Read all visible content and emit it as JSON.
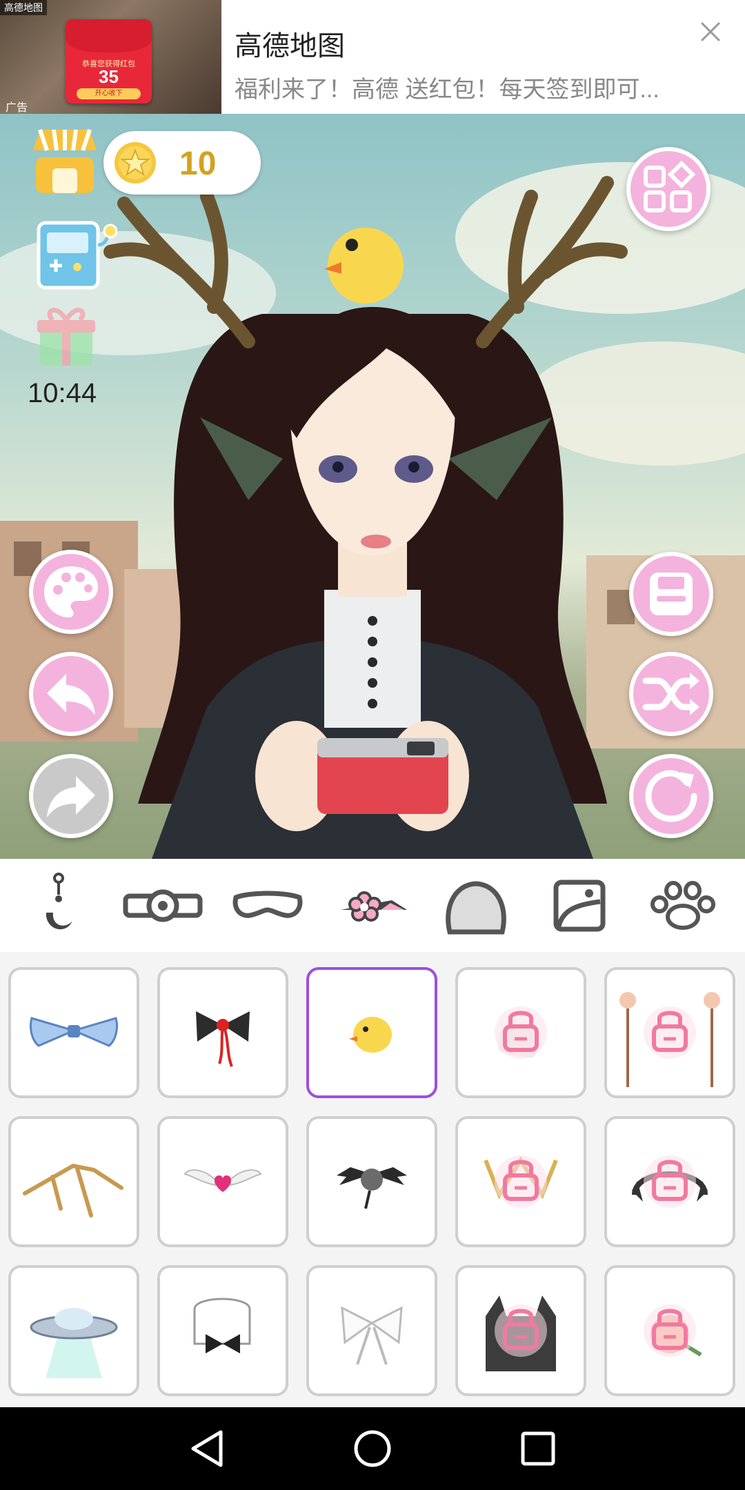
{
  "ad": {
    "app_mark": "高德地图",
    "title": "高德地图",
    "description": "福利来了！高德 送红包！每天签到即可...",
    "tag": "广告",
    "envelope_line": "恭喜您获得红包",
    "envelope_amount": "35",
    "envelope_button": "开心收下",
    "close_icon": "close-icon"
  },
  "hud": {
    "coins": "10",
    "timer": "10:44",
    "icons": {
      "shop": "shop-icon",
      "coin": "star-coin-icon",
      "machine": "gacha-machine-icon",
      "gift": "gift-icon",
      "menu": "menu-grid-icon",
      "palette": "palette-icon",
      "undo": "undo-icon",
      "redo": "redo-icon",
      "save": "save-icon",
      "shuffle": "shuffle-icon",
      "reset": "reset-icon"
    }
  },
  "categories": [
    {
      "id": "earring",
      "icon": "earring-icon"
    },
    {
      "id": "headband",
      "icon": "headband-icon"
    },
    {
      "id": "eye-mask",
      "icon": "eye-mask-icon"
    },
    {
      "id": "hair-accessory",
      "icon": "flower-hairpin-icon",
      "active": true
    },
    {
      "id": "hat",
      "icon": "hat-icon"
    },
    {
      "id": "background",
      "icon": "background-icon"
    },
    {
      "id": "pet",
      "icon": "paw-icon"
    }
  ],
  "items": [
    {
      "name": "blue-bow",
      "locked": false
    },
    {
      "name": "black-bow-red-ribbon",
      "locked": false
    },
    {
      "name": "yellow-chick",
      "locked": false,
      "selected": true
    },
    {
      "name": "card-pin",
      "locked": true
    },
    {
      "name": "flower-hairsticks",
      "locked": true
    },
    {
      "name": "golden-spikes",
      "locked": false
    },
    {
      "name": "winged-heart",
      "locked": false
    },
    {
      "name": "skull-bat",
      "locked": false
    },
    {
      "name": "golden-crown",
      "locked": true
    },
    {
      "name": "bat-wing-headband",
      "locked": true
    },
    {
      "name": "ufo",
      "locked": false
    },
    {
      "name": "maid-bow",
      "locked": false
    },
    {
      "name": "white-bow",
      "locked": false
    },
    {
      "name": "black-cat",
      "locked": true
    },
    {
      "name": "rose",
      "locked": true
    }
  ],
  "colors": {
    "button_pink": "#f3b3dd",
    "selected_border": "#9e4fdc",
    "coin_text": "#d3a21e"
  },
  "nav": {
    "back": "back-triangle-icon",
    "home": "home-circle-icon",
    "recents": "recents-square-icon"
  }
}
